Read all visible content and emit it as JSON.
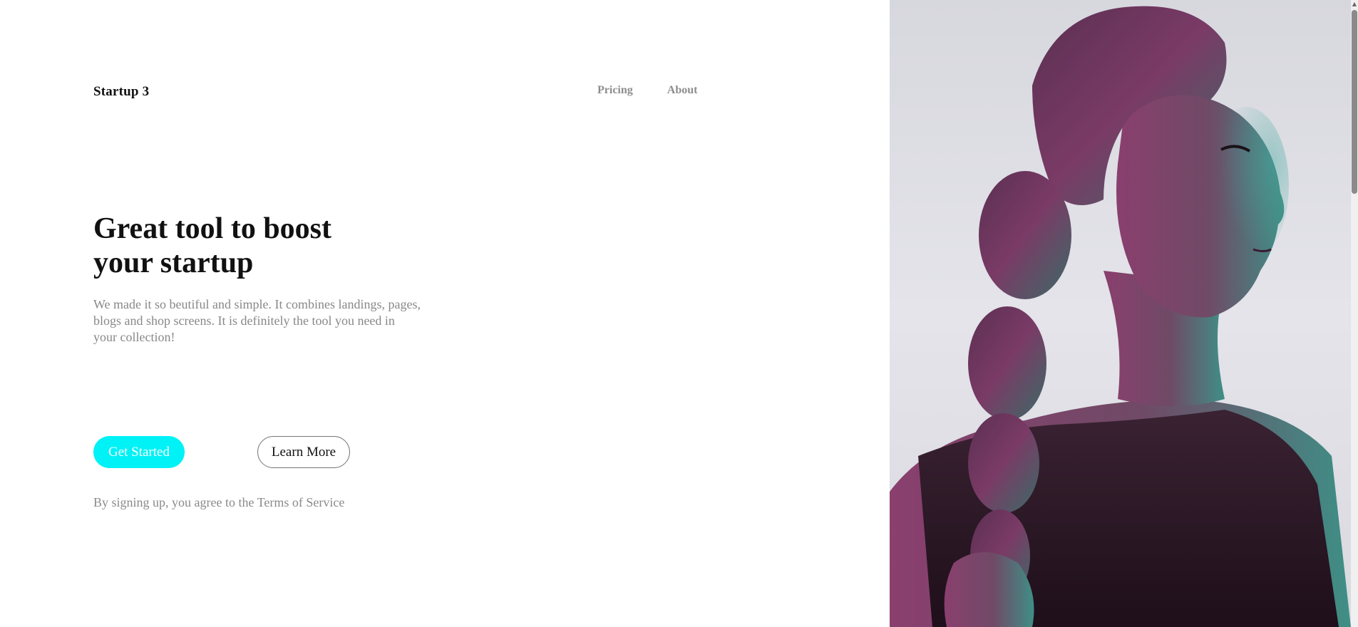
{
  "brand": {
    "name": "Startup 3"
  },
  "nav": {
    "items": [
      {
        "label": "Pricing"
      },
      {
        "label": "About"
      }
    ]
  },
  "hero": {
    "title_line1": "Great tool to boost",
    "title_line2": "your startup",
    "description": "We made it so beutiful and simple. It combines landings, pages, blogs and shop screens. It is definitely the tool you need in your collection!",
    "primary_button": "Get Started",
    "secondary_button": "Learn More",
    "terms_prefix": "By signing up, you agree to the ",
    "terms_link": "Terms of Service"
  },
  "colors": {
    "accent": "#00f2f7",
    "text_dark": "#111111",
    "text_muted": "#888888"
  },
  "icons": {
    "scroll_up": "scroll-up-arrow-icon"
  }
}
